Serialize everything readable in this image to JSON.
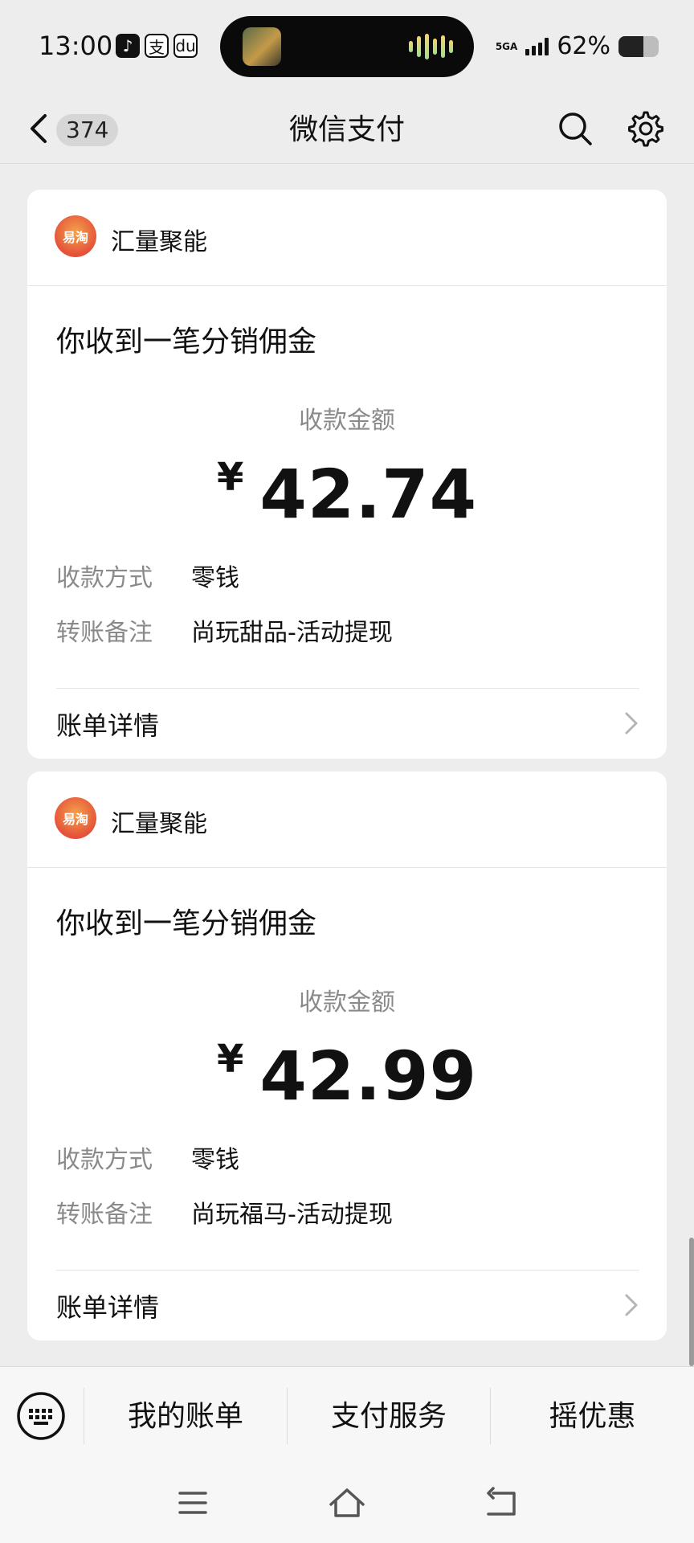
{
  "status": {
    "time": "13:00",
    "apps": [
      "♪",
      "支",
      "du"
    ],
    "network": "5GA",
    "battery_pct": "62%",
    "battery_level": 0.62
  },
  "nav": {
    "unread_count": "374",
    "title": "微信支付"
  },
  "cards": [
    {
      "merchant": "汇量聚能",
      "logo_text": "易淘",
      "title": "你收到一笔分销佣金",
      "amount_label": "收款金额",
      "currency": "¥",
      "amount": "42.74",
      "method_label": "收款方式",
      "method_value": "零钱",
      "note_label": "转账备注",
      "note_value": "尚玩甜品-活动提现",
      "detail_label": "账单详情"
    },
    {
      "merchant": "汇量聚能",
      "logo_text": "易淘",
      "title": "你收到一笔分销佣金",
      "amount_label": "收款金额",
      "currency": "¥",
      "amount": "42.99",
      "method_label": "收款方式",
      "method_value": "零钱",
      "note_label": "转账备注",
      "note_value": "尚玩福马-活动提现",
      "detail_label": "账单详情"
    }
  ],
  "menu": {
    "items": [
      "我的账单",
      "支付服务",
      "摇优惠"
    ]
  },
  "icons": {
    "back": "chevron-left-icon",
    "search": "search-icon",
    "settings": "gear-icon",
    "keyboard": "keyboard-icon",
    "chevron": "chevron-right-icon",
    "sys_menu": "menu-icon",
    "sys_home": "home-icon",
    "sys_back": "back-icon"
  }
}
